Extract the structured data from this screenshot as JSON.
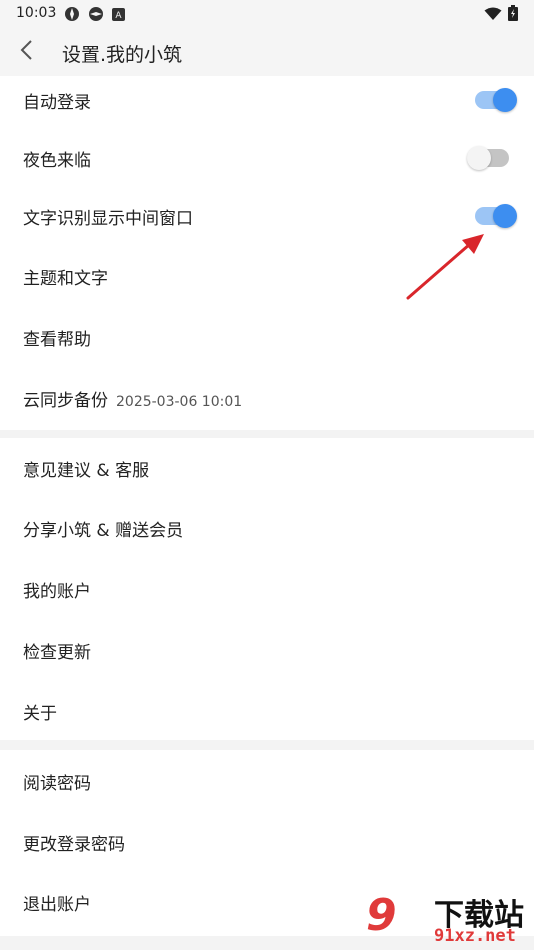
{
  "status_bar": {
    "time": "10:03"
  },
  "header": {
    "title": "设置.我的小筑"
  },
  "group1": [
    {
      "label": "自动登录",
      "toggle": true
    },
    {
      "label": "夜色来临",
      "toggle": false
    },
    {
      "label": "文字识别显示中间窗口",
      "toggle": true
    },
    {
      "label": "主题和文字"
    },
    {
      "label": "查看帮助"
    },
    {
      "label": "云同步备份",
      "sub": "2025-03-06 10:01"
    }
  ],
  "group2": [
    {
      "label": "意见建议 & 客服"
    },
    {
      "label": "分享小筑 & 赠送会员"
    },
    {
      "label": "我的账户"
    },
    {
      "label": "检查更新"
    },
    {
      "label": "关于"
    }
  ],
  "group3": [
    {
      "label": "阅读密码"
    },
    {
      "label": "更改登录密码"
    },
    {
      "label": "退出账户"
    }
  ],
  "watermark": {
    "logo": "9",
    "cn": "下载站",
    "url": "91xz.net"
  },
  "colors": {
    "accent": "#3d8ef0",
    "arrow": "#d9262b"
  }
}
